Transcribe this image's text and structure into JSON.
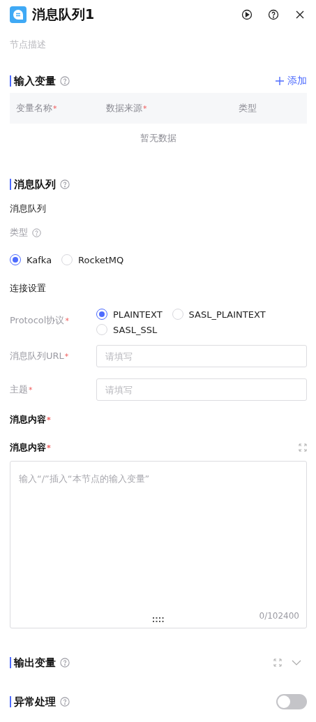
{
  "header": {
    "title": "消息队列1",
    "description_placeholder": "节点描述"
  },
  "input_variables": {
    "title": "输入变量",
    "add_label": "添加",
    "columns": [
      {
        "label": "变量名称",
        "required_mark": "*"
      },
      {
        "label": "数据来源",
        "required_mark": "*"
      },
      {
        "label": "类型"
      }
    ],
    "empty_text": "暂无数据"
  },
  "message_queue": {
    "title": "消息队列",
    "subtitle": "消息队列",
    "type_label": "类型",
    "type_options": [
      {
        "label": "Kafka",
        "selected": true
      },
      {
        "label": "RocketMQ",
        "selected": false
      }
    ],
    "connection_title": "连接设置",
    "protocol": {
      "label": "Protocol协议",
      "required_mark": "*",
      "options": [
        {
          "label": "PLAINTEXT",
          "selected": true
        },
        {
          "label": "SASL_PLAINTEXT",
          "selected": false
        },
        {
          "label": "SASL_SSL",
          "selected": false
        }
      ]
    },
    "fields": [
      {
        "label": "消息队列URL",
        "required_mark": "*",
        "placeholder": "请填写"
      },
      {
        "label": "主题",
        "required_mark": "*",
        "placeholder": "请填写"
      }
    ],
    "content_section": {
      "label": "消息内容",
      "required_mark": "*"
    },
    "editor": {
      "label": "消息内容",
      "required_mark": "*",
      "placeholder": "输入“/”插入“本节点的输入变量”",
      "counter": "0/102400"
    }
  },
  "output_variables": {
    "title": "输出变量"
  },
  "exception_handling": {
    "title": "异常处理",
    "on": false
  }
}
